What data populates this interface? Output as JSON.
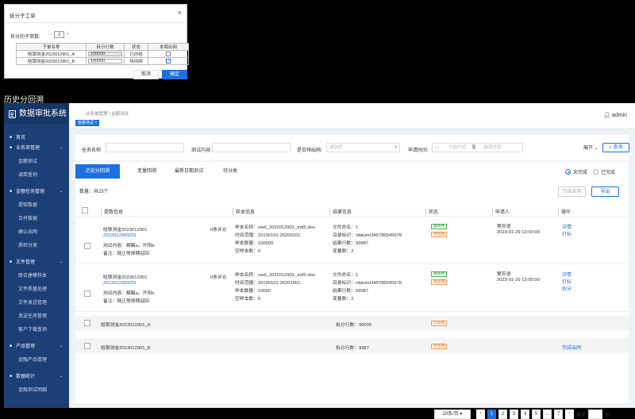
{
  "dialog": {
    "title": "拆分子工单",
    "close": "×",
    "count_label": "拆分的子单数:",
    "count_minus": "−",
    "count_value": "2",
    "count_plus": "+",
    "columns": [
      "子单名称",
      "拆分行数",
      "状态",
      "本周出网"
    ],
    "rows": [
      {
        "name": "晗银测金2023012901_A",
        "lines": "100000",
        "status": "已办结",
        "checked": false
      },
      {
        "name": "晗银测金2023012901_B",
        "lines": "100000",
        "status": "待出网",
        "checked": true
      }
    ],
    "cancel": "取消",
    "ok": "确定"
  },
  "section_label": "历史分回溯",
  "app": {
    "name": "数据审批系统",
    "breadcrumb": "业务单管理 / 金额测试",
    "active_tag": "金额测试 ×",
    "user": "admin"
  },
  "sidebar": {
    "items": [
      {
        "label": "首页",
        "level": "top",
        "icon": "■",
        "chev": ""
      },
      {
        "label": "业务单管理",
        "level": "top",
        "icon": "■",
        "chev": "⌄"
      },
      {
        "label": "金额测试",
        "level": "sub",
        "icon": "",
        "chev": ""
      },
      {
        "label": "调单查询",
        "level": "sub",
        "icon": "",
        "chev": ""
      },
      {
        "label": "金额任务管理",
        "level": "top",
        "icon": "■",
        "chev": "⌄"
      },
      {
        "label": "提取数据",
        "level": "sub",
        "icon": "",
        "chev": ""
      },
      {
        "label": "合并数据",
        "level": "sub",
        "icon": "",
        "chev": ""
      },
      {
        "label": "确认出网",
        "level": "sub",
        "icon": "",
        "chev": ""
      },
      {
        "label": "质检分发",
        "level": "sub",
        "icon": "",
        "chev": ""
      },
      {
        "label": "文件管理",
        "level": "top",
        "icon": "■",
        "chev": "⌄"
      },
      {
        "label": "联合建模样本",
        "level": "sub",
        "icon": "",
        "chev": ""
      },
      {
        "label": "文件质量处理",
        "level": "sub",
        "icon": "",
        "chev": ""
      },
      {
        "label": "文件发送管理",
        "level": "sub",
        "icon": "",
        "chev": ""
      },
      {
        "label": "发送任务管理",
        "level": "sub",
        "icon": "",
        "chev": ""
      },
      {
        "label": "客户下载查询",
        "level": "sub",
        "icon": "",
        "chev": ""
      },
      {
        "label": "产品管理",
        "level": "top",
        "icon": "■",
        "chev": "⌄"
      },
      {
        "label": "金融产品管理",
        "level": "sub",
        "icon": "",
        "chev": ""
      },
      {
        "label": "数据统计",
        "level": "top",
        "icon": "■",
        "chev": "⌄"
      },
      {
        "label": "金融测试明细",
        "level": "sub",
        "icon": "",
        "chev": ""
      }
    ]
  },
  "filters": {
    "task_name_label": "任务名称:",
    "test_content_label": "测试内容:",
    "is_pre_out_label": "是否预出网:",
    "is_pre_out_placeholder": "请选择",
    "apply_time_label": "申请时间:",
    "start_placeholder": "开始时间",
    "to": "至",
    "end_placeholder": "结束时间",
    "expand": "展开",
    "search": "查询"
  },
  "tabs": [
    "历史分回溯",
    "变量回溯",
    "最新日期测试",
    "待分类"
  ],
  "radio": {
    "incomplete": "未完成",
    "complete": "已完成"
  },
  "count_text": "数量：共25个",
  "buttons": {
    "finish_out": "完成出网",
    "export": "导出"
  },
  "columns": [
    "提数信息",
    "样本信息",
    "结果信息",
    "状态",
    "申请人",
    "操作"
  ],
  "records": [
    {
      "name": "晗银测金2023012901",
      "id": "2023012900001",
      "test": "测试内容：解酶a，开阳b",
      "note": "备注：随正常择期返回",
      "comments": "0条评论",
      "sample_name": "样本名称：nwd_2022012901_md5.xlsx",
      "time_range": "时间范围：20190101-20200101",
      "sample_count": "样本数量：100000",
      "empty_count": "空样本数：0",
      "file_count": "文件命名：1",
      "dir": "目录标识：/datum/345786545678",
      "result_rows": "结果行数：99987",
      "var_count": "变量数：2",
      "status1": "进转中",
      "status2": "待出网",
      "applicant": "樊芳语",
      "time": "2023-01-29 13:00:00",
      "ops": [
        "详情",
        "打标"
      ]
    },
    {
      "name": "晗银测金2023012901",
      "id": "2023012900001",
      "test": "测试内容：解酶a，开阳b",
      "note": "备注：随正常择期返回",
      "comments": "0条评论",
      "sample_name": "样本名称：nwd_2022012901_md5.xlsx",
      "time_range": "时间范围：20190101-20201001",
      "sample_count": "样本数量：10000",
      "empty_count": "空样本数：0",
      "file_count": "文件命名：1",
      "dir": "目录标识：/datum/345786545678",
      "result_rows": "结果行数：99987",
      "var_count": "变量数：2",
      "status1": "进转中",
      "status2": "待出网",
      "applicant": "樊芳语",
      "time": "2023-01-29 13:00:00",
      "ops": [
        "详情",
        "打标",
        "拆分"
      ]
    }
  ],
  "subrows": [
    {
      "name": "晗银测金2023012901_A",
      "lines": "拆分行数：90000",
      "status": "已办结",
      "op": ""
    },
    {
      "name": "晗银测金2023012901_B",
      "lines": "拆分行数：9987",
      "status": "待出网",
      "op": "完成出网"
    }
  ],
  "pager": {
    "page_size": "20条/页 ▾",
    "prev": "‹",
    "pages": [
      "1",
      "2",
      "3",
      "4",
      "5",
      "...",
      "7"
    ],
    "next": "›",
    "jump": "跳至",
    "unit": "页"
  },
  "colors": {
    "primary": "#1e6fe0",
    "sidebar": "#1c3f78"
  }
}
